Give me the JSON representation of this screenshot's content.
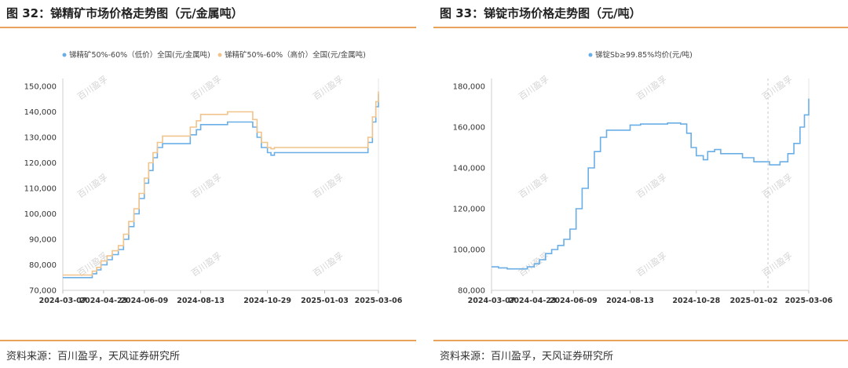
{
  "left_panel": {
    "title": "图 32：锑精矿市场价格走势图（元/金属吨）",
    "source": "资料来源：百川盈孚，天风证券研究所"
  },
  "right_panel": {
    "title": "图 33：锑锭市场价格走势图（元/吨）",
    "source": "资料来源：百川盈孚，天风证券研究所"
  },
  "watermark": "百川盈孚",
  "chart_data": [
    {
      "type": "line",
      "title": "",
      "xlabel": "",
      "ylabel": "",
      "ylim": [
        70000,
        150000
      ],
      "y_ticks": [
        "70,000",
        "80,000",
        "90,000",
        "100,000",
        "110,000",
        "120,000",
        "130,000",
        "140,000",
        "150,000"
      ],
      "y_tick_values": [
        70000,
        80000,
        90000,
        100000,
        110000,
        120000,
        130000,
        140000,
        150000
      ],
      "x_ticks": [
        "2024-03-07",
        "2024-04-23",
        "2024-06-09",
        "2024-08-13",
        "2024-10-29",
        "2025-01-03",
        "2025-03-06"
      ],
      "x_range": [
        "2024-03-07",
        "2025-03-06"
      ],
      "grid": false,
      "legend_position": "top",
      "series": [
        {
          "name": "锑精矿50%-60%（低价）全国(元/金属吨)",
          "color": "#6aaee6",
          "points": [
            [
              "2024-03-07",
              75000
            ],
            [
              "2024-04-05",
              75000
            ],
            [
              "2024-04-10",
              76500
            ],
            [
              "2024-04-15",
              78000
            ],
            [
              "2024-04-20",
              80000
            ],
            [
              "2024-04-27",
              82000
            ],
            [
              "2024-05-03",
              84000
            ],
            [
              "2024-05-10",
              86000
            ],
            [
              "2024-05-16",
              90000
            ],
            [
              "2024-05-22",
              95000
            ],
            [
              "2024-05-28",
              100000
            ],
            [
              "2024-06-03",
              106000
            ],
            [
              "2024-06-09",
              112000
            ],
            [
              "2024-06-14",
              117000
            ],
            [
              "2024-06-19",
              122000
            ],
            [
              "2024-06-24",
              126000
            ],
            [
              "2024-06-30",
              127500
            ],
            [
              "2024-07-25",
              127500
            ],
            [
              "2024-08-01",
              131000
            ],
            [
              "2024-08-08",
              133000
            ],
            [
              "2024-08-13",
              135000
            ],
            [
              "2024-09-10",
              135000
            ],
            [
              "2024-09-13",
              136000
            ],
            [
              "2024-10-05",
              136000
            ],
            [
              "2024-10-12",
              134000
            ],
            [
              "2024-10-17",
              130000
            ],
            [
              "2024-10-22",
              126000
            ],
            [
              "2024-10-29",
              124000
            ],
            [
              "2024-11-02",
              123000
            ],
            [
              "2024-11-06",
              124000
            ],
            [
              "2024-12-15",
              124000
            ],
            [
              "2025-01-03",
              124000
            ],
            [
              "2025-02-17",
              124000
            ],
            [
              "2025-02-22",
              128000
            ],
            [
              "2025-02-27",
              136000
            ],
            [
              "2025-03-03",
              142000
            ],
            [
              "2025-03-06",
              147000
            ]
          ]
        },
        {
          "name": "锑精矿50%-60%（高价）全国(元/金属吨)",
          "color": "#f0c48c",
          "points": [
            [
              "2024-03-07",
              76000
            ],
            [
              "2024-04-05",
              76000
            ],
            [
              "2024-04-10",
              77500
            ],
            [
              "2024-04-15",
              79000
            ],
            [
              "2024-04-20",
              81500
            ],
            [
              "2024-04-27",
              83500
            ],
            [
              "2024-05-03",
              85500
            ],
            [
              "2024-05-10",
              87500
            ],
            [
              "2024-05-16",
              92000
            ],
            [
              "2024-05-22",
              97000
            ],
            [
              "2024-05-28",
              102000
            ],
            [
              "2024-06-03",
              108000
            ],
            [
              "2024-06-09",
              114000
            ],
            [
              "2024-06-14",
              120000
            ],
            [
              "2024-06-19",
              124000
            ],
            [
              "2024-06-24",
              128000
            ],
            [
              "2024-06-30",
              130500
            ],
            [
              "2024-07-25",
              130500
            ],
            [
              "2024-08-01",
              134000
            ],
            [
              "2024-08-08",
              136500
            ],
            [
              "2024-08-13",
              139000
            ],
            [
              "2024-09-10",
              139000
            ],
            [
              "2024-09-13",
              140000
            ],
            [
              "2024-10-05",
              140000
            ],
            [
              "2024-10-12",
              137000
            ],
            [
              "2024-10-17",
              132000
            ],
            [
              "2024-10-22",
              128000
            ],
            [
              "2024-10-29",
              126000
            ],
            [
              "2024-11-02",
              125500
            ],
            [
              "2024-11-06",
              126000
            ],
            [
              "2024-12-15",
              126000
            ],
            [
              "2025-01-03",
              126000
            ],
            [
              "2025-02-17",
              126000
            ],
            [
              "2025-02-22",
              130000
            ],
            [
              "2025-02-27",
              138000
            ],
            [
              "2025-03-03",
              144000
            ],
            [
              "2025-03-06",
              148000
            ]
          ]
        }
      ]
    },
    {
      "type": "line",
      "title": "",
      "xlabel": "",
      "ylabel": "",
      "ylim": [
        80000,
        180000
      ],
      "y_ticks": [
        "80,000",
        "100,000",
        "120,000",
        "140,000",
        "160,000",
        "180,000"
      ],
      "y_tick_values": [
        80000,
        100000,
        120000,
        140000,
        160000,
        180000
      ],
      "x_ticks": [
        "2024-03-07",
        "2024-04-23",
        "2024-06-09",
        "2024-08-13",
        "2024-10-28",
        "2025-01-02",
        "2025-03-06"
      ],
      "x_range": [
        "2024-03-07",
        "2025-03-06"
      ],
      "grid": false,
      "legend_position": "top",
      "marker_date": "2025-01-02",
      "series": [
        {
          "name": "锑锭Sb≥99.85%均价(元/吨)",
          "color": "#6aaee6",
          "points": [
            [
              "2024-03-07",
              91500
            ],
            [
              "2024-03-15",
              91000
            ],
            [
              "2024-03-25",
              90500
            ],
            [
              "2024-04-10",
              90500
            ],
            [
              "2024-04-17",
              91500
            ],
            [
              "2024-04-25",
              93000
            ],
            [
              "2024-05-01",
              95000
            ],
            [
              "2024-05-08",
              98000
            ],
            [
              "2024-05-15",
              100000
            ],
            [
              "2024-05-22",
              102000
            ],
            [
              "2024-05-29",
              105000
            ],
            [
              "2024-06-05",
              110000
            ],
            [
              "2024-06-12",
              120000
            ],
            [
              "2024-06-19",
              130000
            ],
            [
              "2024-06-26",
              140000
            ],
            [
              "2024-07-03",
              148000
            ],
            [
              "2024-07-10",
              155000
            ],
            [
              "2024-07-17",
              158500
            ],
            [
              "2024-08-06",
              158500
            ],
            [
              "2024-08-13",
              161000
            ],
            [
              "2024-08-25",
              161500
            ],
            [
              "2024-09-15",
              161500
            ],
            [
              "2024-09-25",
              162000
            ],
            [
              "2024-10-10",
              161500
            ],
            [
              "2024-10-17",
              157000
            ],
            [
              "2024-10-22",
              150000
            ],
            [
              "2024-10-28",
              146000
            ],
            [
              "2024-11-05",
              144000
            ],
            [
              "2024-11-10",
              148000
            ],
            [
              "2024-11-18",
              149000
            ],
            [
              "2024-11-25",
              147000
            ],
            [
              "2024-12-10",
              147000
            ],
            [
              "2024-12-20",
              145000
            ],
            [
              "2025-01-02",
              143000
            ],
            [
              "2025-01-20",
              141500
            ],
            [
              "2025-02-01",
              143000
            ],
            [
              "2025-02-10",
              147000
            ],
            [
              "2025-02-17",
              152000
            ],
            [
              "2025-02-24",
              160000
            ],
            [
              "2025-03-01",
              166000
            ],
            [
              "2025-03-06",
              174000
            ]
          ]
        }
      ]
    }
  ]
}
